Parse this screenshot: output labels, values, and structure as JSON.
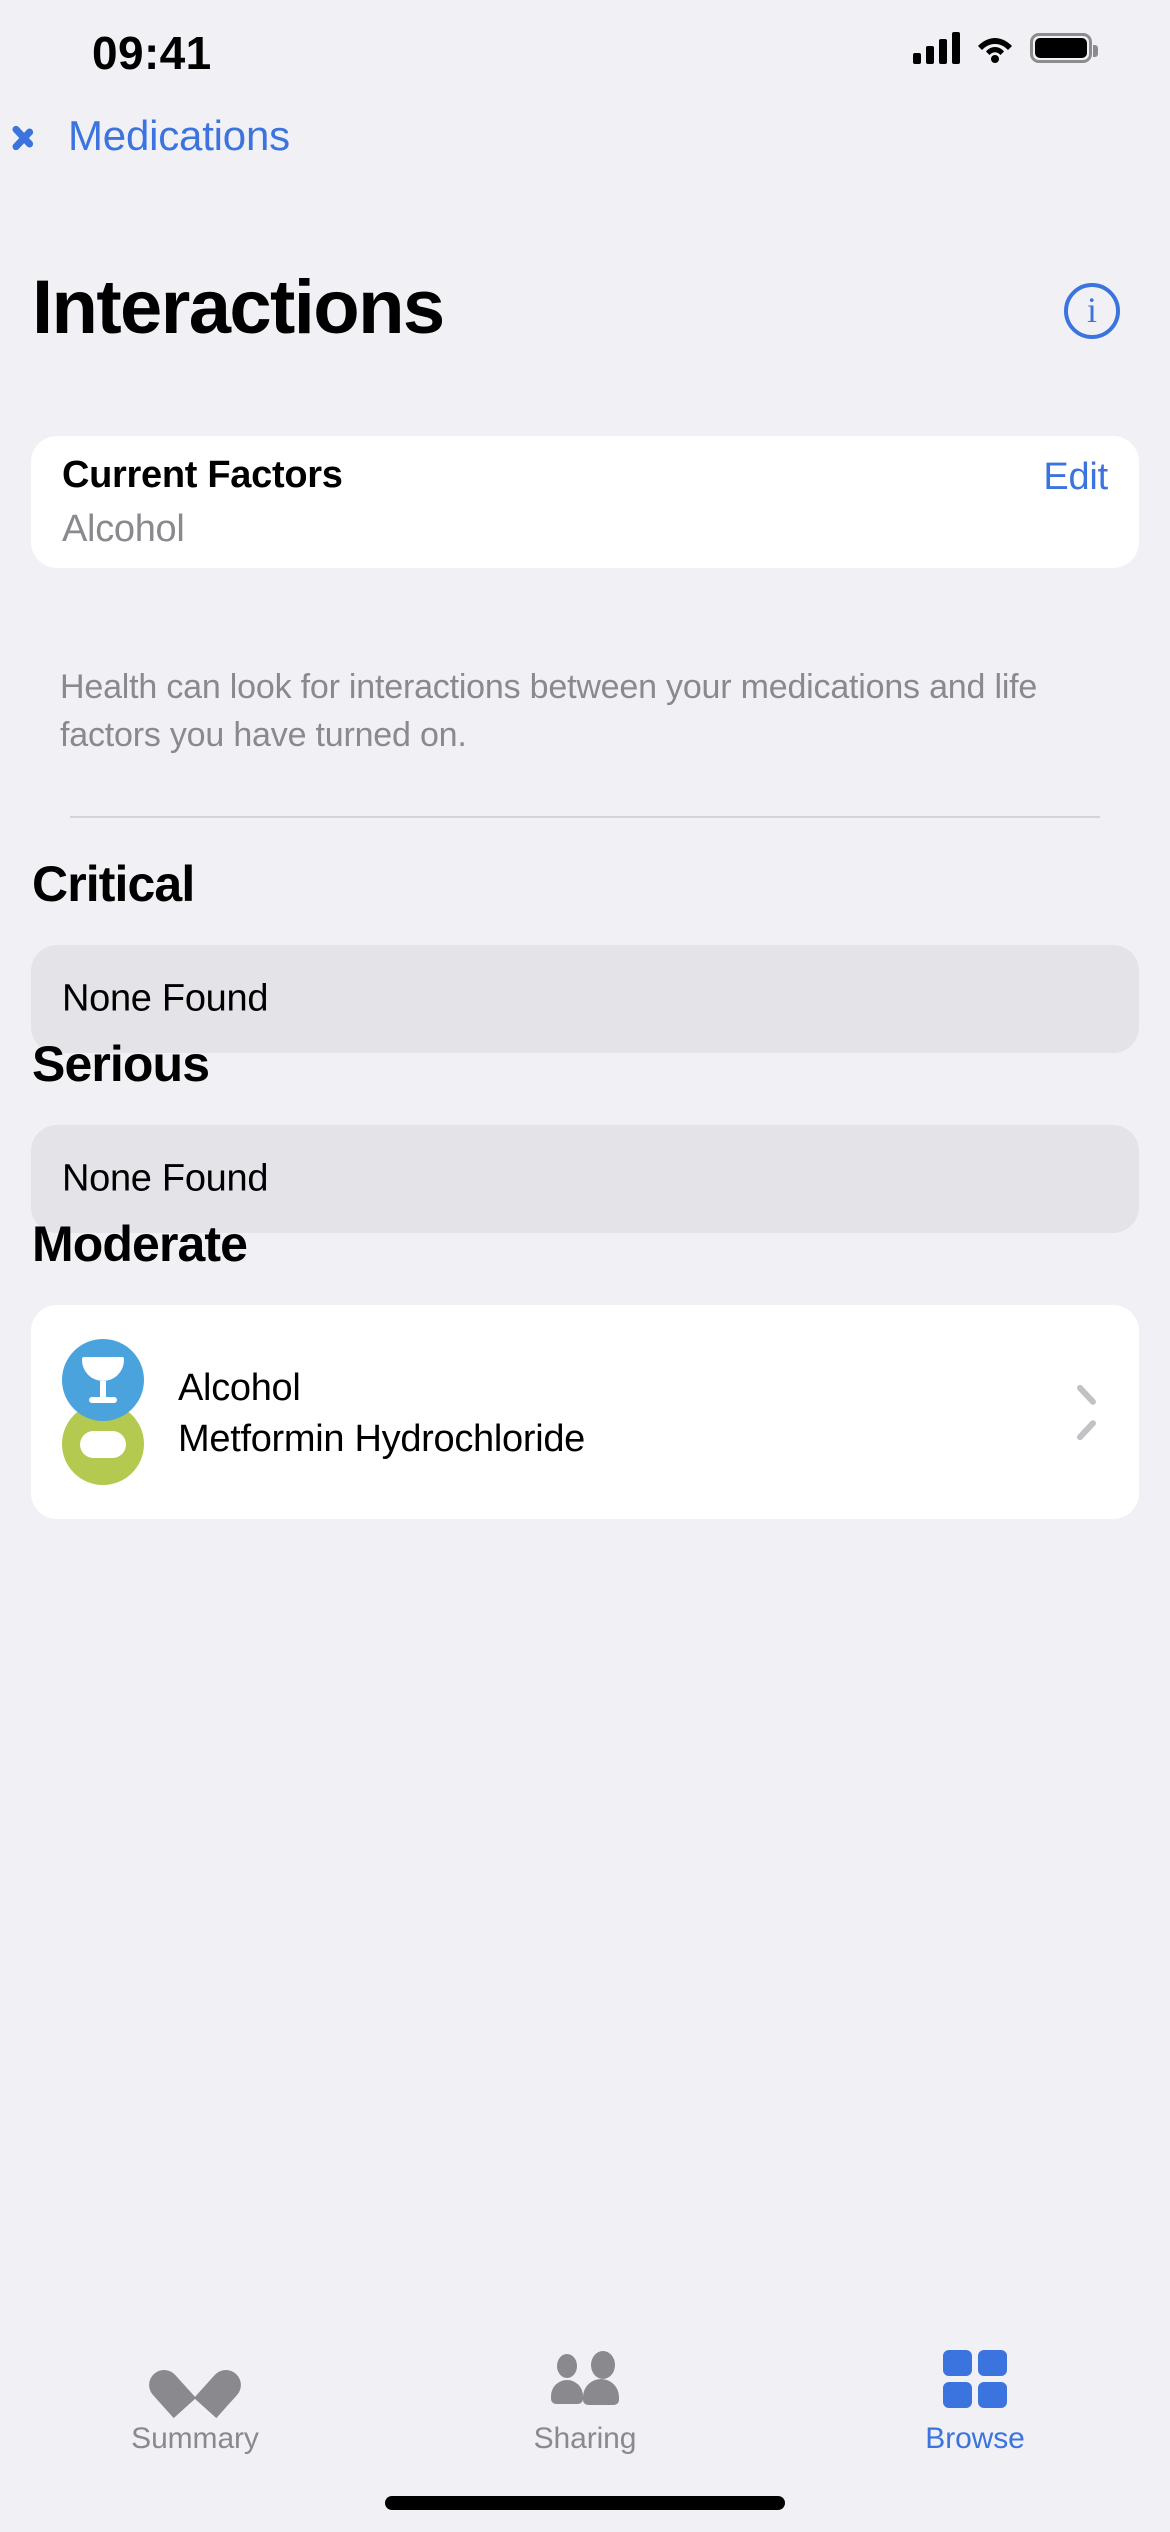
{
  "status_bar": {
    "time": "09:41",
    "cellular_icon": "signal-bars-icon",
    "wifi_icon": "wifi-icon",
    "battery_icon": "battery-icon"
  },
  "nav": {
    "back_label": "Medications",
    "back_icon": "chevron-left-icon",
    "accent_color": "#3B74DE"
  },
  "header": {
    "title": "Interactions",
    "info_icon": "info-circle-icon",
    "info_glyph": "i"
  },
  "current_factors": {
    "title": "Current Factors",
    "value": "Alcohol",
    "edit_label": "Edit"
  },
  "footnote": "Health can look for interactions between your medications and life factors you have turned on.",
  "sections": [
    {
      "heading": "Critical",
      "empty_label": "None Found"
    },
    {
      "heading": "Serious",
      "empty_label": "None Found"
    },
    {
      "heading": "Moderate",
      "empty_label": ""
    }
  ],
  "moderate_interaction": {
    "line1": "Alcohol",
    "line2": "Metformin Hydrochloride",
    "icon1": "wine-glass-icon",
    "icon2": "pill-icon",
    "icon1_color": "#4BA3DD",
    "icon2_color": "#B3C94F",
    "chevron_icon": "chevron-right-icon"
  },
  "tab_bar": {
    "tabs": [
      {
        "label": "Summary",
        "icon": "heart-icon",
        "active": false
      },
      {
        "label": "Sharing",
        "icon": "people-icon",
        "active": false
      },
      {
        "label": "Browse",
        "icon": "grid-icon",
        "active": true
      }
    ],
    "active_color": "#3B74DE",
    "inactive_color": "#8A8A8E"
  }
}
